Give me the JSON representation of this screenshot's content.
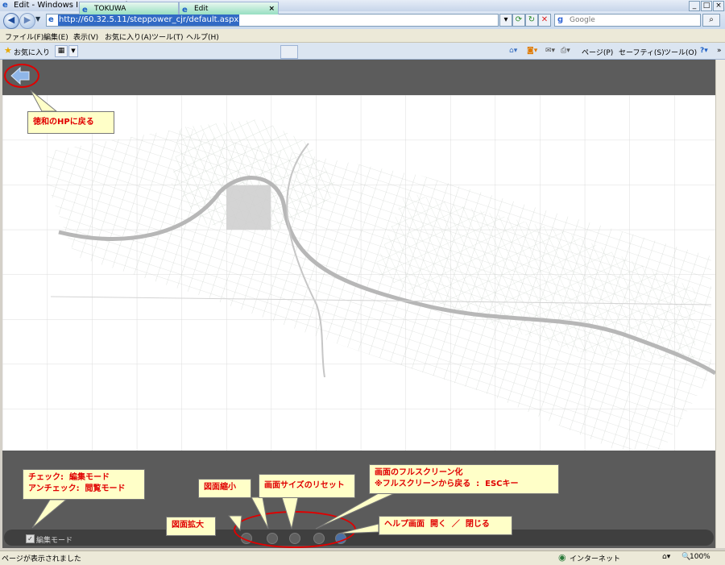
{
  "window": {
    "title": "Edit - Windows Internet Explorer"
  },
  "address": {
    "url": "http://60.32.5.11/steppower_cjr/default.aspx",
    "search_placeholder": "Google"
  },
  "menu": {
    "items": [
      "ファイル(F)",
      "編集(E)",
      "表示(V)",
      "お気に入り(A)",
      "ツール(T)",
      "ヘルプ(H)"
    ]
  },
  "favorites": {
    "label": "お気に入り"
  },
  "tabs": [
    {
      "label": "TOKUWA"
    },
    {
      "label": "Edit"
    }
  ],
  "commandbar": {
    "page": "ページ(P)",
    "safety": "セーフティ(S)",
    "tools": "ツール(O)"
  },
  "app": {
    "edit_mode_label": "編集モード",
    "edit_mode_checked": true
  },
  "callouts": {
    "back": "徳和のHPに戻る",
    "mode": "チェック:  編集モード\nアンチェック:  閲覧モード",
    "zoom_out": "図面縮小",
    "reset": "画面サイズのリセット",
    "fullscreen": "画面のフルスクリーン化\n※フルスクリーンから戻る  :  ESCキー",
    "zoom_in": "図面拡大",
    "help": "ヘルプ画面  開く  ／  閉じる"
  },
  "status": {
    "text": "ページが表示されました",
    "zone": "インターネット",
    "zoom": "100%"
  },
  "colors": {
    "callout_bg": "#ffffc8",
    "callout_text": "#e00000",
    "highlight": "#e00000",
    "app_bg": "#5b5b5b"
  }
}
